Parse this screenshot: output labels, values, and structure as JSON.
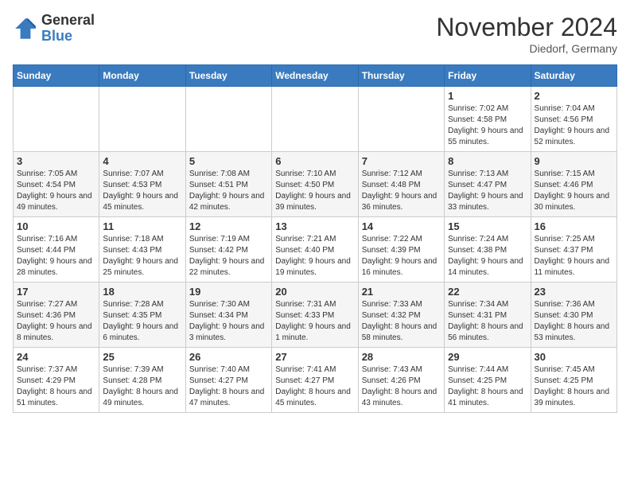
{
  "logo": {
    "general": "General",
    "blue": "Blue"
  },
  "title": {
    "month": "November 2024",
    "location": "Diedorf, Germany"
  },
  "weekdays": [
    "Sunday",
    "Monday",
    "Tuesday",
    "Wednesday",
    "Thursday",
    "Friday",
    "Saturday"
  ],
  "weeks": [
    [
      {
        "day": "",
        "info": ""
      },
      {
        "day": "",
        "info": ""
      },
      {
        "day": "",
        "info": ""
      },
      {
        "day": "",
        "info": ""
      },
      {
        "day": "",
        "info": ""
      },
      {
        "day": "1",
        "info": "Sunrise: 7:02 AM\nSunset: 4:58 PM\nDaylight: 9 hours and 55 minutes."
      },
      {
        "day": "2",
        "info": "Sunrise: 7:04 AM\nSunset: 4:56 PM\nDaylight: 9 hours and 52 minutes."
      }
    ],
    [
      {
        "day": "3",
        "info": "Sunrise: 7:05 AM\nSunset: 4:54 PM\nDaylight: 9 hours and 49 minutes."
      },
      {
        "day": "4",
        "info": "Sunrise: 7:07 AM\nSunset: 4:53 PM\nDaylight: 9 hours and 45 minutes."
      },
      {
        "day": "5",
        "info": "Sunrise: 7:08 AM\nSunset: 4:51 PM\nDaylight: 9 hours and 42 minutes."
      },
      {
        "day": "6",
        "info": "Sunrise: 7:10 AM\nSunset: 4:50 PM\nDaylight: 9 hours and 39 minutes."
      },
      {
        "day": "7",
        "info": "Sunrise: 7:12 AM\nSunset: 4:48 PM\nDaylight: 9 hours and 36 minutes."
      },
      {
        "day": "8",
        "info": "Sunrise: 7:13 AM\nSunset: 4:47 PM\nDaylight: 9 hours and 33 minutes."
      },
      {
        "day": "9",
        "info": "Sunrise: 7:15 AM\nSunset: 4:46 PM\nDaylight: 9 hours and 30 minutes."
      }
    ],
    [
      {
        "day": "10",
        "info": "Sunrise: 7:16 AM\nSunset: 4:44 PM\nDaylight: 9 hours and 28 minutes."
      },
      {
        "day": "11",
        "info": "Sunrise: 7:18 AM\nSunset: 4:43 PM\nDaylight: 9 hours and 25 minutes."
      },
      {
        "day": "12",
        "info": "Sunrise: 7:19 AM\nSunset: 4:42 PM\nDaylight: 9 hours and 22 minutes."
      },
      {
        "day": "13",
        "info": "Sunrise: 7:21 AM\nSunset: 4:40 PM\nDaylight: 9 hours and 19 minutes."
      },
      {
        "day": "14",
        "info": "Sunrise: 7:22 AM\nSunset: 4:39 PM\nDaylight: 9 hours and 16 minutes."
      },
      {
        "day": "15",
        "info": "Sunrise: 7:24 AM\nSunset: 4:38 PM\nDaylight: 9 hours and 14 minutes."
      },
      {
        "day": "16",
        "info": "Sunrise: 7:25 AM\nSunset: 4:37 PM\nDaylight: 9 hours and 11 minutes."
      }
    ],
    [
      {
        "day": "17",
        "info": "Sunrise: 7:27 AM\nSunset: 4:36 PM\nDaylight: 9 hours and 8 minutes."
      },
      {
        "day": "18",
        "info": "Sunrise: 7:28 AM\nSunset: 4:35 PM\nDaylight: 9 hours and 6 minutes."
      },
      {
        "day": "19",
        "info": "Sunrise: 7:30 AM\nSunset: 4:34 PM\nDaylight: 9 hours and 3 minutes."
      },
      {
        "day": "20",
        "info": "Sunrise: 7:31 AM\nSunset: 4:33 PM\nDaylight: 9 hours and 1 minute."
      },
      {
        "day": "21",
        "info": "Sunrise: 7:33 AM\nSunset: 4:32 PM\nDaylight: 8 hours and 58 minutes."
      },
      {
        "day": "22",
        "info": "Sunrise: 7:34 AM\nSunset: 4:31 PM\nDaylight: 8 hours and 56 minutes."
      },
      {
        "day": "23",
        "info": "Sunrise: 7:36 AM\nSunset: 4:30 PM\nDaylight: 8 hours and 53 minutes."
      }
    ],
    [
      {
        "day": "24",
        "info": "Sunrise: 7:37 AM\nSunset: 4:29 PM\nDaylight: 8 hours and 51 minutes."
      },
      {
        "day": "25",
        "info": "Sunrise: 7:39 AM\nSunset: 4:28 PM\nDaylight: 8 hours and 49 minutes."
      },
      {
        "day": "26",
        "info": "Sunrise: 7:40 AM\nSunset: 4:27 PM\nDaylight: 8 hours and 47 minutes."
      },
      {
        "day": "27",
        "info": "Sunrise: 7:41 AM\nSunset: 4:27 PM\nDaylight: 8 hours and 45 minutes."
      },
      {
        "day": "28",
        "info": "Sunrise: 7:43 AM\nSunset: 4:26 PM\nDaylight: 8 hours and 43 minutes."
      },
      {
        "day": "29",
        "info": "Sunrise: 7:44 AM\nSunset: 4:25 PM\nDaylight: 8 hours and 41 minutes."
      },
      {
        "day": "30",
        "info": "Sunrise: 7:45 AM\nSunset: 4:25 PM\nDaylight: 8 hours and 39 minutes."
      }
    ]
  ]
}
